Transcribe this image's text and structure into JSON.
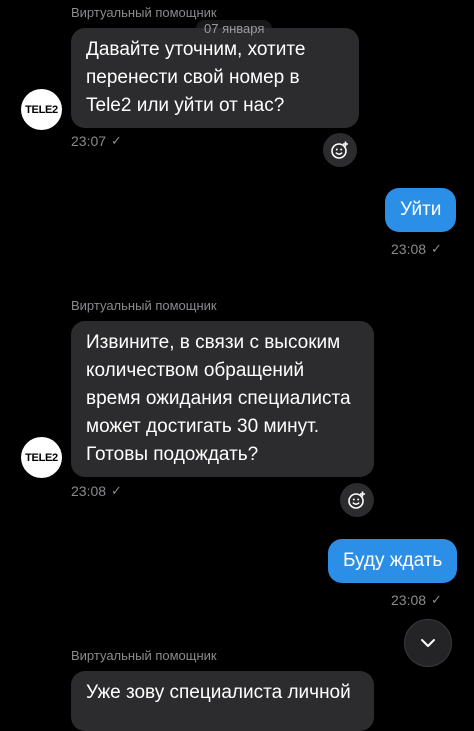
{
  "chat": {
    "date_separator": "07 января",
    "messages": [
      {
        "sender": "Виртуальный помощник",
        "avatar_text": "TELE2",
        "text": "Давайте уточним, хотите перенести свой номер в Tele2 или уйти от нас?",
        "time": "23:07"
      },
      {
        "text": "Уйти",
        "time": "23:08"
      },
      {
        "sender": "Виртуальный помощник",
        "avatar_text": "TELE2",
        "text": "Извините, в связи с высоким количеством обращений время ожидания специалиста может достигать 30 минут. Готовы подождать?",
        "time": "23:08"
      },
      {
        "text": "Буду ждать",
        "time": "23:08"
      },
      {
        "sender": "Виртуальный помощник",
        "text": "Уже зову специалиста личной"
      }
    ]
  },
  "icons": {
    "reaction": "smile-plus-icon",
    "read_status": "check-icon",
    "scroll_down": "chevron-down-icon"
  },
  "colors": {
    "background": "#000000",
    "incoming_bubble": "#2c2c2e",
    "outgoing_bubble": "#2b8fe8",
    "meta_text": "#8b8b8f"
  }
}
